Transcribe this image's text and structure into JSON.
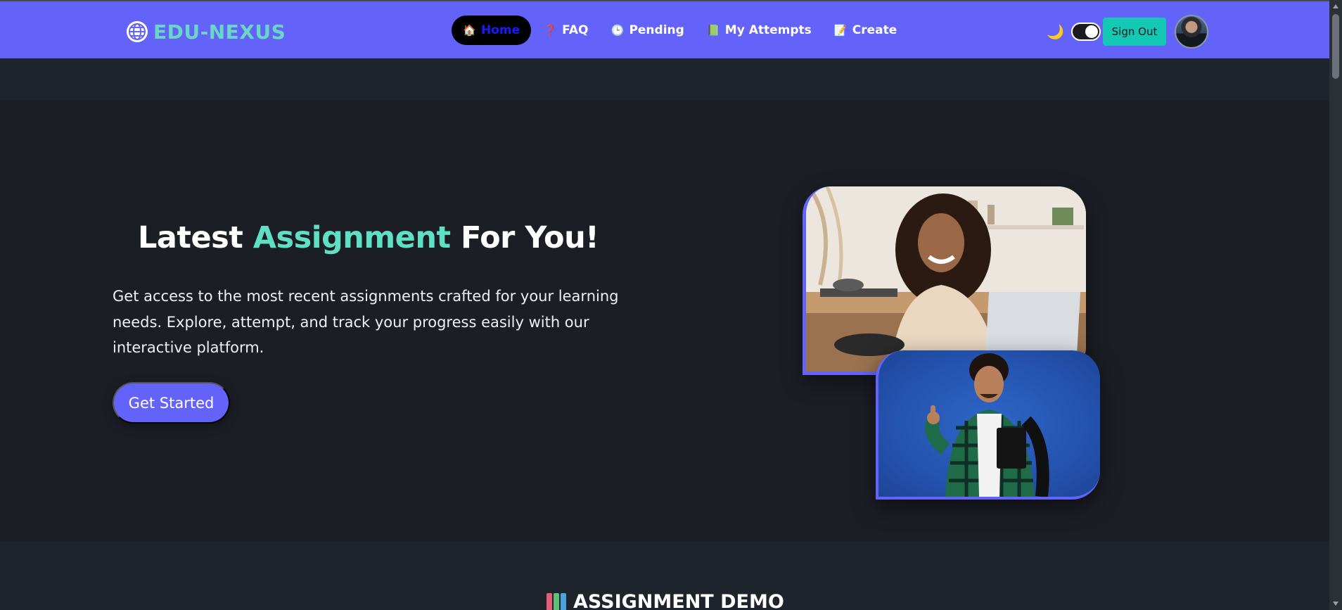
{
  "brand": {
    "name": "EDU-NEXUS",
    "icon": "globe-icon"
  },
  "nav": {
    "items": [
      {
        "label": "Home",
        "icon": "🏠",
        "active": true
      },
      {
        "label": "FAQ",
        "icon": "❓",
        "active": false
      },
      {
        "label": "Pending",
        "icon": "🕒",
        "active": false
      },
      {
        "label": "My Attempts",
        "icon": "📗",
        "active": false
      },
      {
        "label": "Create",
        "icon": "📝",
        "active": false
      }
    ]
  },
  "header": {
    "theme_icon": "🌙",
    "theme_toggle_on": true,
    "signout_label": "Sign Out"
  },
  "hero": {
    "title_start": "Latest ",
    "title_accent": "Assignment",
    "title_end": " For You!",
    "description": "Get access to the most recent assignments crafted for your learning needs. Explore, attempt, and track your progress easily with our interactive platform.",
    "cta_label": "Get Started"
  },
  "section": {
    "title": "ASSIGNMENT DEMO"
  },
  "colors": {
    "nav_bg": "#6363f9",
    "accent": "#5fe0c5",
    "signout_bg": "#14c8b4",
    "page_bg": "#1f232b",
    "hero_bg": "#1b1e25"
  }
}
